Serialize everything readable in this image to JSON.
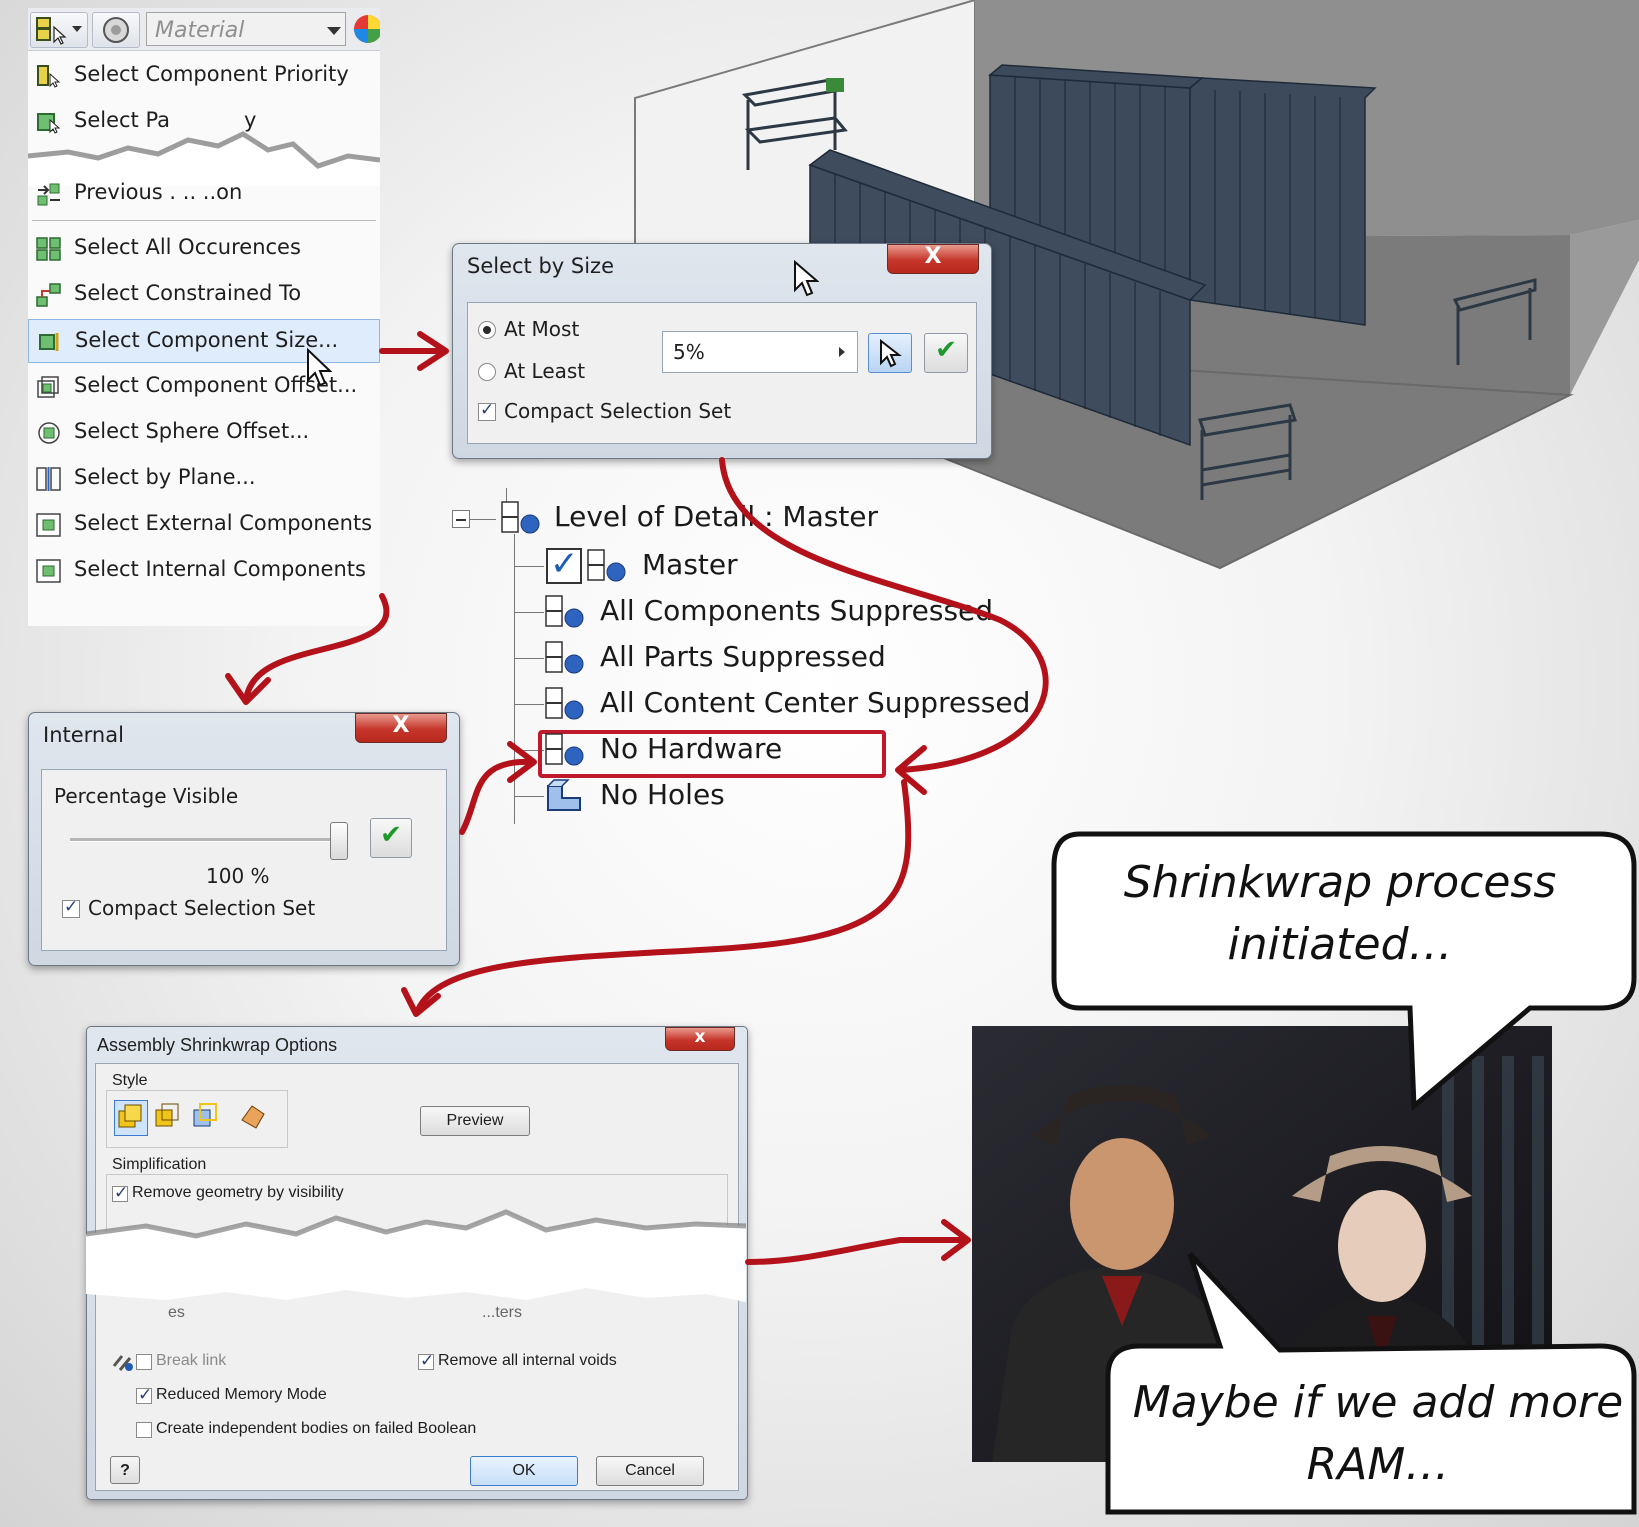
{
  "menu": {
    "material_placeholder": "Material",
    "items": [
      {
        "label": "Select Component Priority",
        "icon": "select-priority-icon"
      },
      {
        "label": "Select Pa",
        "fragment_end": "y",
        "icon": "select-part-icon"
      },
      {
        "label": "Previous . ..   ..on",
        "icon": "previous-selection-icon"
      },
      {
        "label": "Select All Occurences",
        "icon": "all-occurrences-icon"
      },
      {
        "label": "Select Constrained To",
        "icon": "constrained-to-icon"
      },
      {
        "label": "Select Component Size...",
        "icon": "component-size-icon",
        "highlighted": true
      },
      {
        "label": "Select Component Offset...",
        "icon": "component-offset-icon"
      },
      {
        "label": "Select Sphere Offset...",
        "icon": "sphere-offset-icon"
      },
      {
        "label": "Select by Plane...",
        "icon": "plane-icon"
      },
      {
        "label": "Select External Components",
        "icon": "external-components-icon"
      },
      {
        "label": "Select Internal Components",
        "icon": "internal-components-icon"
      }
    ]
  },
  "select_by_size": {
    "title": "Select by Size",
    "at_most": "At Most",
    "at_least": "At Least",
    "value": "5%",
    "compact": "Compact Selection Set",
    "selected_mode": "At Most",
    "compact_checked": true
  },
  "internal": {
    "title": "Internal",
    "percentage_label": "Percentage Visible",
    "percentage_value": "100 %",
    "slider_fraction": 1.0,
    "compact": "Compact Selection Set",
    "compact_checked": true
  },
  "tree": {
    "root": "Level of Detail : Master",
    "items": [
      {
        "label": "Master",
        "checked": true
      },
      {
        "label": "All Components Suppressed"
      },
      {
        "label": "All Parts Suppressed"
      },
      {
        "label": "All Content Center Suppressed"
      },
      {
        "label": "No Hardware",
        "highlighted": true
      },
      {
        "label": "No Holes"
      }
    ]
  },
  "shrinkwrap": {
    "title": "Assembly Shrinkwrap Options",
    "style_label": "Style",
    "preview": "Preview",
    "simplification_label": "Simplification",
    "remove_visibility": "Remove geometry by visibility",
    "torn_left": "es",
    "torn_right": "...ters",
    "break_link": "Break link",
    "remove_voids": "Remove all internal voids",
    "reduced_memory": "Reduced Memory Mode",
    "independent_bodies": "Create independent bodies on failed Boolean",
    "help": "?",
    "ok": "OK",
    "cancel": "Cancel"
  },
  "bubbles": {
    "top": [
      "Shrinkwrap process",
      "initiated…"
    ],
    "bottom": [
      "Maybe if we add more",
      "RAM…"
    ]
  },
  "colors": {
    "arrow": "#b3121b",
    "highlight_box": "#c0192b",
    "menu_highlight": "#dfecfb",
    "close_red": "#c5352a"
  }
}
